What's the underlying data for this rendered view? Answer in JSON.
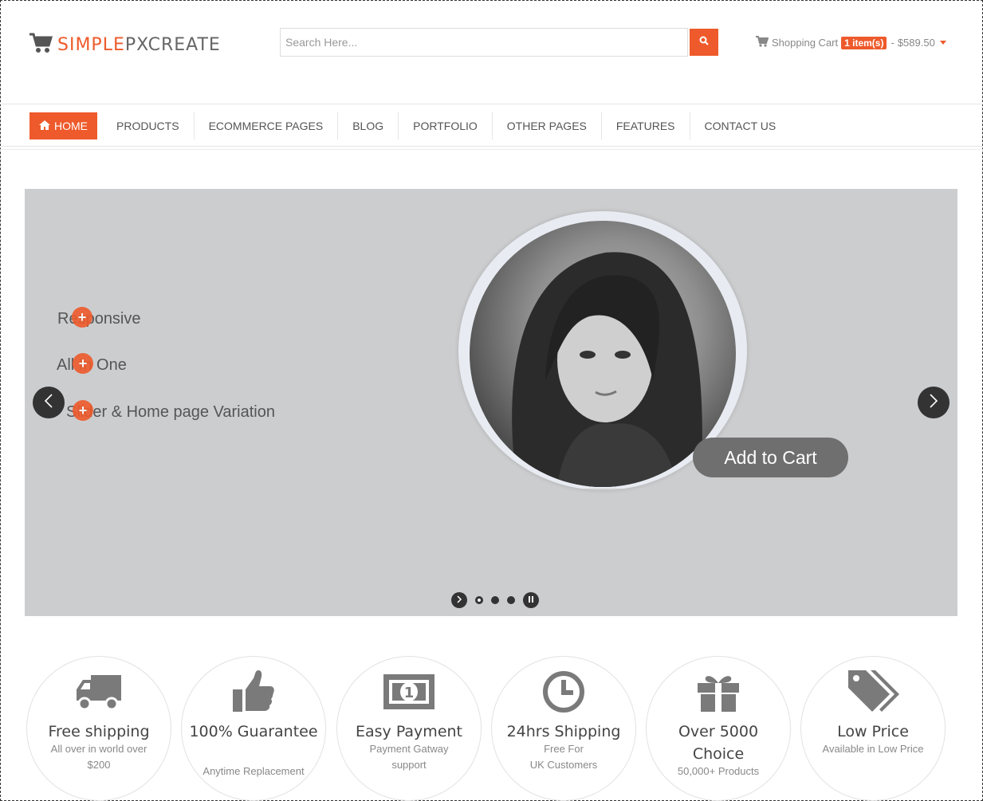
{
  "header": {
    "logo_part1": "SIMPLE",
    "logo_part2": "PXCREATE",
    "logo_icon": "cart-icon",
    "search_placeholder": "Search Here...",
    "search_icon": "search-icon",
    "cart_label": "Shopping Cart",
    "cart_badge": "1 item(s)",
    "cart_separator": "-",
    "cart_total": "$589.50"
  },
  "nav": {
    "items": [
      {
        "label": "HOME",
        "icon": "home-icon"
      },
      {
        "label": "PRODUCTS"
      },
      {
        "label": "ECOMMERCE PAGES"
      },
      {
        "label": "BLOG"
      },
      {
        "label": "PORTFOLIO"
      },
      {
        "label": "OTHER PAGES"
      },
      {
        "label": "FEATURES"
      },
      {
        "label": "CONTACT US"
      }
    ]
  },
  "slider": {
    "lines": [
      "Responsive",
      "All In One",
      "Slider & Home page Variation"
    ],
    "plus_glyph": "+",
    "cta": "Add to Cart",
    "bullets": 3,
    "active_bullet": 1
  },
  "features": [
    {
      "title": "Free shipping",
      "sub": [
        "All over in world over",
        "$200"
      ],
      "icon": "truck-icon"
    },
    {
      "title": "100% Guarantee",
      "sub": [
        "Anytime Replacement"
      ],
      "icon": "thumbs-up-icon"
    },
    {
      "title": "Easy Payment",
      "sub": [
        "Payment Gatway",
        "support"
      ],
      "icon": "money-icon"
    },
    {
      "title": "24hrs Shipping",
      "sub": [
        "Free For",
        "UK Customers"
      ],
      "icon": "clock-icon"
    },
    {
      "title": "Over 5000 Choice",
      "sub": [
        "50,000+ Products"
      ],
      "icon": "gift-icon"
    },
    {
      "title": "Low Price",
      "sub": [
        "Available in Low Price"
      ],
      "icon": "tags-icon"
    }
  ],
  "colors": {
    "accent": "#ee5a2b",
    "slider_bg": "#cccdcf",
    "icon_gray": "#7a7a7a"
  }
}
